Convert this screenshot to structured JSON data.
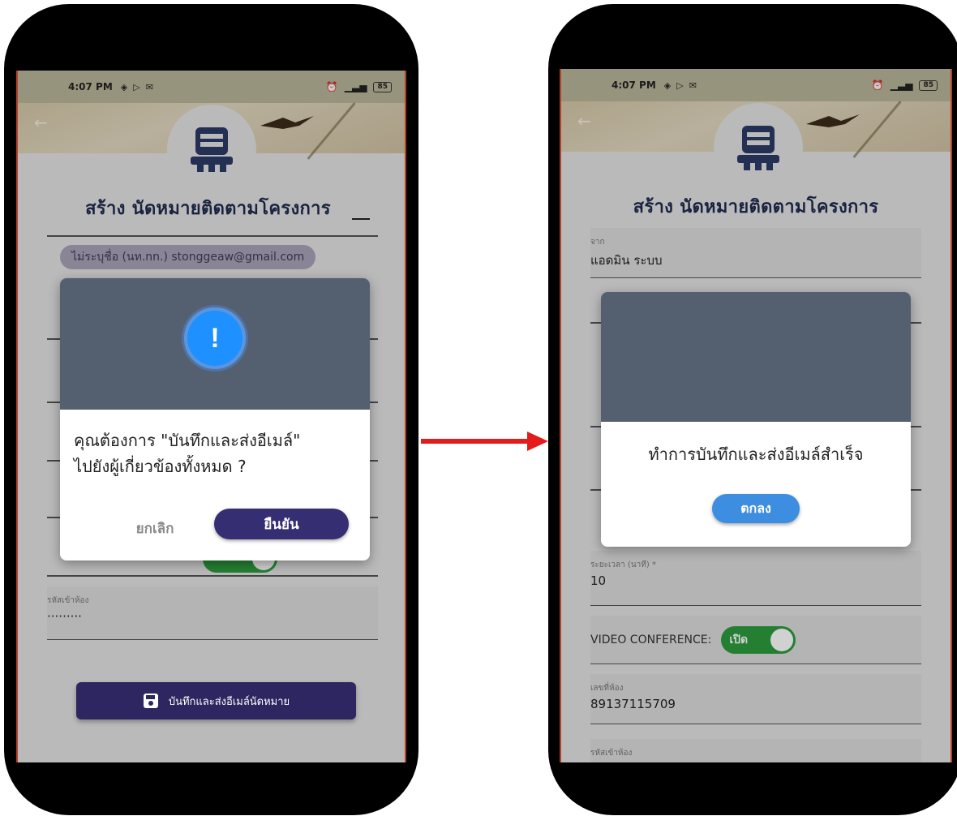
{
  "status_bar": {
    "time": "4:07 PM",
    "battery": "85"
  },
  "page_title": "สร้าง นัดหมายติดตามโครงการ",
  "left_phone": {
    "email_chip": "ไม่ระบุชื่อ (นท.nn.) stonggeaw@gmail.com",
    "dialog_message_line1": "คุณต้องการ \"บันทึกและส่งอีเมล์\"",
    "dialog_message_line2": "ไปยังผู้เกี่ยวข้องทั้งหมด ?",
    "cancel_label": "ยกเลิก",
    "confirm_label": "ยืนยัน",
    "room_password_label": "รหัสเข้าห้อง",
    "room_password_value": "·········",
    "save_button_label": "บันทึกและส่งอีเมล์นัดหมาย"
  },
  "right_phone": {
    "from_label": "จาก",
    "from_value": "แอดมิน ระบบ",
    "dialog_message": "ทำการบันทึกและส่งอีเมล์สำเร็จ",
    "ok_label": "ตกลง",
    "duration_label": "ระยะเวลา (นาที) *",
    "duration_value": "10",
    "video_conference_label": "VIDEO CONFERENCE:",
    "toggle_label": "เปิด",
    "room_number_label": "เลขที่ห้อง",
    "room_number_value": "89137115709",
    "room_password_label": "รหัสเข้าห้อง"
  },
  "colors": {
    "dialog_header": "#545f70",
    "confirm_button": "#362e72",
    "ok_button": "#3d8ee0",
    "alert_icon": "#1e90ff",
    "toggle_on": "#2c9c3f",
    "arrow": "#e41b1b"
  }
}
